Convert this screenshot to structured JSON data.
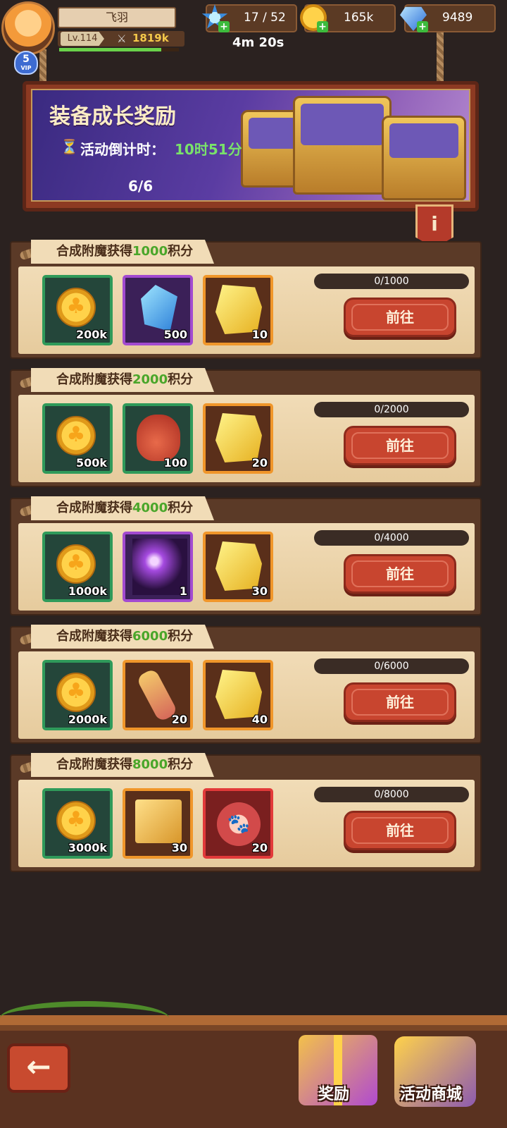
{
  "player": {
    "name": "飞羽",
    "level": "Lv.114",
    "power": "1819k",
    "vip_level": "5",
    "vip_label": "VIP",
    "xp_progress": 0.85
  },
  "resources": {
    "stamina": "17 / 52",
    "stamina_timer": "4m 20s",
    "gold": "165k",
    "gems": "9489"
  },
  "banner": {
    "title": "装备成长奖励",
    "countdown_label": "活动倒计时：",
    "countdown_value": "10时51分",
    "progress": "6/6",
    "info_label": "i"
  },
  "tasks": [
    {
      "title_pre": "合成附魔获得",
      "title_num": "1000",
      "title_post": "积分",
      "progress": "0/1000",
      "button": "前往",
      "rewards": [
        {
          "icon": "gold-coin-icon",
          "qty": "200k",
          "rarity": "green"
        },
        {
          "icon": "blue-crystal-icon",
          "qty": "500",
          "rarity": "purple"
        },
        {
          "icon": "gold-ore-icon",
          "qty": "10",
          "rarity": "orange"
        }
      ]
    },
    {
      "title_pre": "合成附魔获得",
      "title_num": "2000",
      "title_post": "积分",
      "progress": "0/2000",
      "button": "前往",
      "rewards": [
        {
          "icon": "gold-coin-icon",
          "qty": "500k",
          "rarity": "green"
        },
        {
          "icon": "red-bag-icon",
          "qty": "100",
          "rarity": "green"
        },
        {
          "icon": "gold-ore-icon",
          "qty": "20",
          "rarity": "orange"
        }
      ]
    },
    {
      "title_pre": "合成附魔获得",
      "title_num": "4000",
      "title_post": "积分",
      "progress": "0/4000",
      "button": "前往",
      "rewards": [
        {
          "icon": "gold-coin-icon",
          "qty": "1000k",
          "rarity": "green"
        },
        {
          "icon": "lightning-staff-icon",
          "qty": "1",
          "rarity": "purple"
        },
        {
          "icon": "gold-ore-icon",
          "qty": "30",
          "rarity": "orange"
        }
      ]
    },
    {
      "title_pre": "合成附魔获得",
      "title_num": "6000",
      "title_post": "积分",
      "progress": "0/6000",
      "button": "前往",
      "rewards": [
        {
          "icon": "gold-coin-icon",
          "qty": "2000k",
          "rarity": "green"
        },
        {
          "icon": "scroll-icon",
          "qty": "20",
          "rarity": "orange"
        },
        {
          "icon": "gold-ore-icon",
          "qty": "40",
          "rarity": "orange"
        }
      ]
    },
    {
      "title_pre": "合成附魔获得",
      "title_num": "8000",
      "title_post": "积分",
      "progress": "0/8000",
      "button": "前往",
      "rewards": [
        {
          "icon": "gold-coin-icon",
          "qty": "3000k",
          "rarity": "green"
        },
        {
          "icon": "spell-book-icon",
          "qty": "30",
          "rarity": "orange"
        },
        {
          "icon": "paw-token-icon",
          "qty": "20",
          "rarity": "red"
        }
      ]
    }
  ],
  "bottom_nav": {
    "back_icon": "←",
    "rewards_label": "奖励",
    "shop_label": "活动商城"
  },
  "colors": {
    "highlight_number": "#4aa62a",
    "countdown": "#79e26a",
    "button": "#c8452f"
  }
}
